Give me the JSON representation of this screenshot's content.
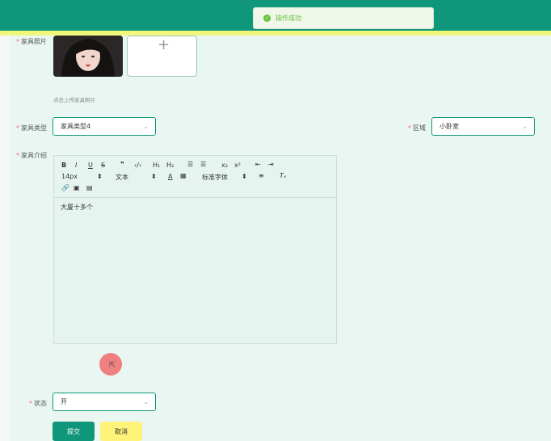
{
  "toast": {
    "message": "操作成功"
  },
  "form": {
    "photo_label": "家具照片",
    "upload_hint": "点击上传家具照片",
    "type_label": "家具类型",
    "type_value": "家具类型4",
    "area_label": "区域",
    "area_value": "小卧室",
    "intro_label": "家具介绍",
    "status_label": "状态",
    "status_value": "开"
  },
  "editor": {
    "font_size": "14px",
    "text_style": "文本",
    "font_family": "标准字体",
    "content": "大厦十多个"
  },
  "buttons": {
    "submit": "提交",
    "cancel": "取消"
  },
  "colors": {
    "primary": "#10967a",
    "accent_yellow": "#f1f77a",
    "required": "#f56c6c"
  }
}
